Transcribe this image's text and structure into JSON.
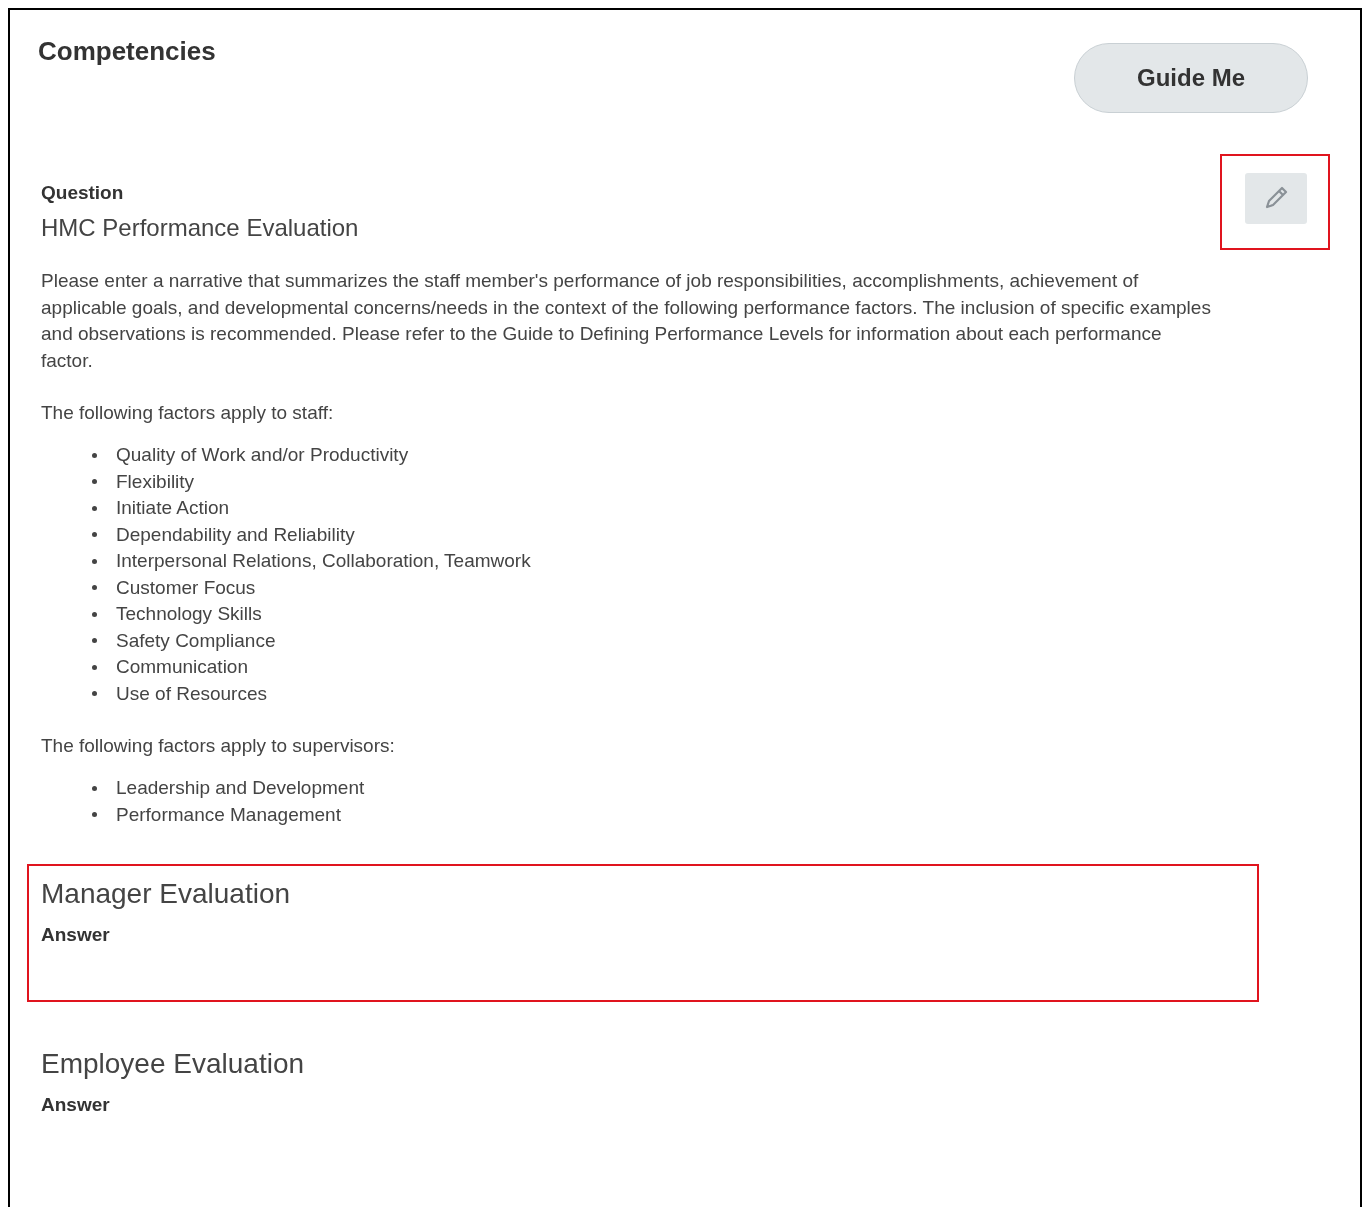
{
  "title": "Competencies",
  "guide_button": "Guide Me",
  "question": {
    "label": "Question",
    "title": "HMC Performance Evaluation",
    "edit_highlighted": true
  },
  "intro": "Please enter a narrative that summarizes the staff member's performance of job responsibilities, accomplishments, achievement of applicable goals, and developmental concerns/needs in the context of the following performance factors. The inclusion of specific examples and observations is recommended. Please refer to the Guide to Defining Performance Levels for information about each performance factor.",
  "staff_heading": "The following factors apply to staff:",
  "staff_factors": [
    "Quality of Work and/or Productivity",
    "Flexibility",
    "Initiate Action",
    "Dependability and Reliability",
    "Interpersonal Relations, Collaboration, Teamwork",
    "Customer Focus",
    "Technology Skills",
    "Safety Compliance",
    "Communication",
    "Use of Resources"
  ],
  "supervisor_heading": "The following factors apply to supervisors:",
  "supervisor_factors": [
    "Leadership and Development",
    "Performance Management"
  ],
  "sections": [
    {
      "title": "Manager Evaluation",
      "answer_label": "Answer",
      "highlighted": true
    },
    {
      "title": "Employee Evaluation",
      "answer_label": "Answer",
      "highlighted": false
    }
  ]
}
